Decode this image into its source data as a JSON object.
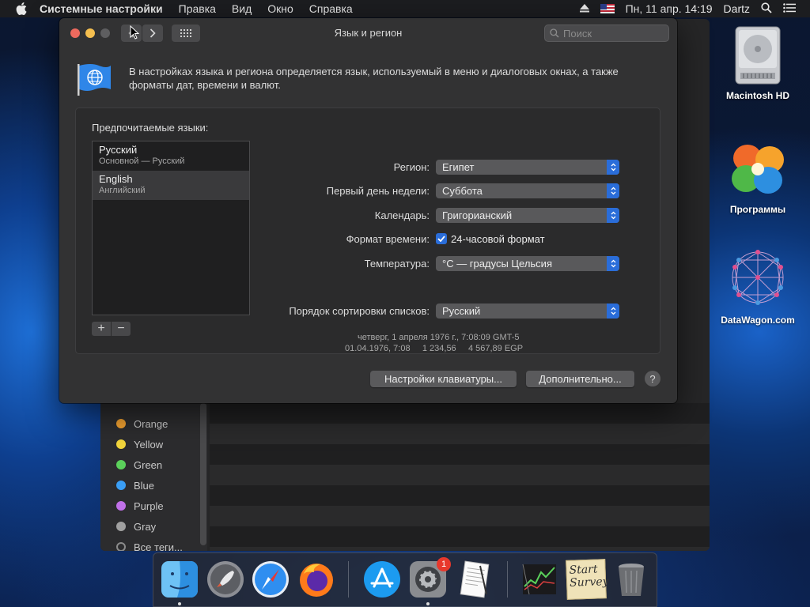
{
  "menubar": {
    "app": "Системные настройки",
    "items": [
      "Правка",
      "Вид",
      "Окно",
      "Справка"
    ],
    "datetime": "Пн, 11 апр.  14:19",
    "user": "Dartz"
  },
  "window": {
    "title": "Язык и регион",
    "search_placeholder": "Поиск",
    "intro": "В настройках языка и региона определяется язык, используемый в меню и диалоговых окнах, а также форматы дат, времени и валют."
  },
  "languages": {
    "label": "Предпочитаемые языки:",
    "items": [
      {
        "name": "Русский",
        "sub": "Основной — Русский"
      },
      {
        "name": "English",
        "sub": "Английский"
      }
    ],
    "add": "+",
    "remove": "−"
  },
  "settings": {
    "region_label": "Регион:",
    "region_value": "Египет",
    "firstday_label": "Первый день недели:",
    "firstday_value": "Суббота",
    "calendar_label": "Календарь:",
    "calendar_value": "Григорианский",
    "timeformat_label": "Формат времени:",
    "timeformat_value": "24-часовой формат",
    "temp_label": "Температура:",
    "temp_value": "°C — градусы Цельсия",
    "sort_label": "Порядок сортировки списков:",
    "sort_value": "Русский",
    "sample_line1": "четверг, 1 апреля 1976 г., 7:08:09 GMT-5",
    "sample_line2": "01.04.1976, 7:08     1 234,56     4 567,89 EGP"
  },
  "buttons": {
    "keyboard": "Настройки клавиатуры...",
    "advanced": "Дополнительно...",
    "help": "?"
  },
  "finder_tags": [
    {
      "name": "Orange",
      "color": "#f0a030"
    },
    {
      "name": "Yellow",
      "color": "#f2d53c"
    },
    {
      "name": "Green",
      "color": "#5bd15b"
    },
    {
      "name": "Blue",
      "color": "#3a9ef5"
    },
    {
      "name": "Purple",
      "color": "#c070e8"
    },
    {
      "name": "Gray",
      "color": "#a0a0a0"
    },
    {
      "name": "Все теги...",
      "color": ""
    }
  ],
  "desktop": {
    "hd": "Macintosh HD",
    "apps": "Программы",
    "datawagon": "DataWagon.com"
  },
  "dock": {
    "survey_text": "Start Survey",
    "prefs_badge": "1"
  },
  "colors": {
    "accent": "#2a6dd9",
    "window_bg": "#323233"
  }
}
